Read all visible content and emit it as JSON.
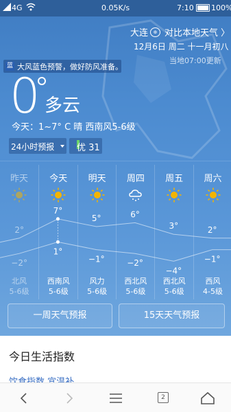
{
  "status_bar": {
    "network": "4G",
    "speed": "0.05K/s",
    "time": "7:10",
    "battery": "100%"
  },
  "header": {
    "city": "大连",
    "city_badge": "⊕",
    "compare": "对比本地天气 〉",
    "date": "12月6日 周二 十一月初八",
    "update": "当地07:00更新"
  },
  "alert": {
    "tag": "蓝",
    "text": "大风蓝色预警，做好防风准备。"
  },
  "current": {
    "temp": "0",
    "condition": "多云",
    "today": "今天：1~7° C  晴  西南风5-6级",
    "forecast_toggle": "24小时预报",
    "aqi": "优 31"
  },
  "forecast": [
    {
      "day": "昨天",
      "icon": "sun-icon",
      "high": "2°",
      "low": "−2°",
      "wind1": "北风",
      "wind2": "5-6级",
      "dim": true
    },
    {
      "day": "今天",
      "icon": "sun-icon",
      "high": "7°",
      "low": "1°",
      "wind1": "西南风",
      "wind2": "5-6级",
      "dim": false
    },
    {
      "day": "明天",
      "icon": "sun-icon",
      "high": "5°",
      "low": "−1°",
      "wind1": "风力",
      "wind2": "5-6级",
      "dim": false
    },
    {
      "day": "周四",
      "icon": "snow-cloud-icon",
      "high": "6°",
      "low": "−2°",
      "wind1": "西北风",
      "wind2": "5-6级",
      "dim": false
    },
    {
      "day": "周五",
      "icon": "sun-icon",
      "high": "3°",
      "low": "−4°",
      "wind1": "西北风",
      "wind2": "5-6级",
      "dim": false
    },
    {
      "day": "周六",
      "icon": "sun-icon",
      "high": "2°",
      "low": "−1°",
      "wind1": "西风",
      "wind2": "4-5级",
      "dim": false
    }
  ],
  "chart_data": {
    "type": "line",
    "categories": [
      "昨天",
      "今天",
      "明天",
      "周四",
      "周五",
      "周六"
    ],
    "series": [
      {
        "name": "",
        "values": [
          2,
          7,
          5,
          6,
          3,
          2
        ]
      },
      {
        "name": "",
        "values": [
          -2,
          1,
          -1,
          -2,
          -4,
          -1
        ]
      }
    ]
  },
  "buttons": {
    "week": "一周天气预报",
    "fifteen": "15天天气预报"
  },
  "life": {
    "title": "今日生活指数",
    "sub": "饮食指数    宜温补"
  },
  "nav": {
    "tabs_count": "2"
  },
  "colors": {
    "accent": "#3a6fc4",
    "aqi_good": "#6bd46b"
  }
}
